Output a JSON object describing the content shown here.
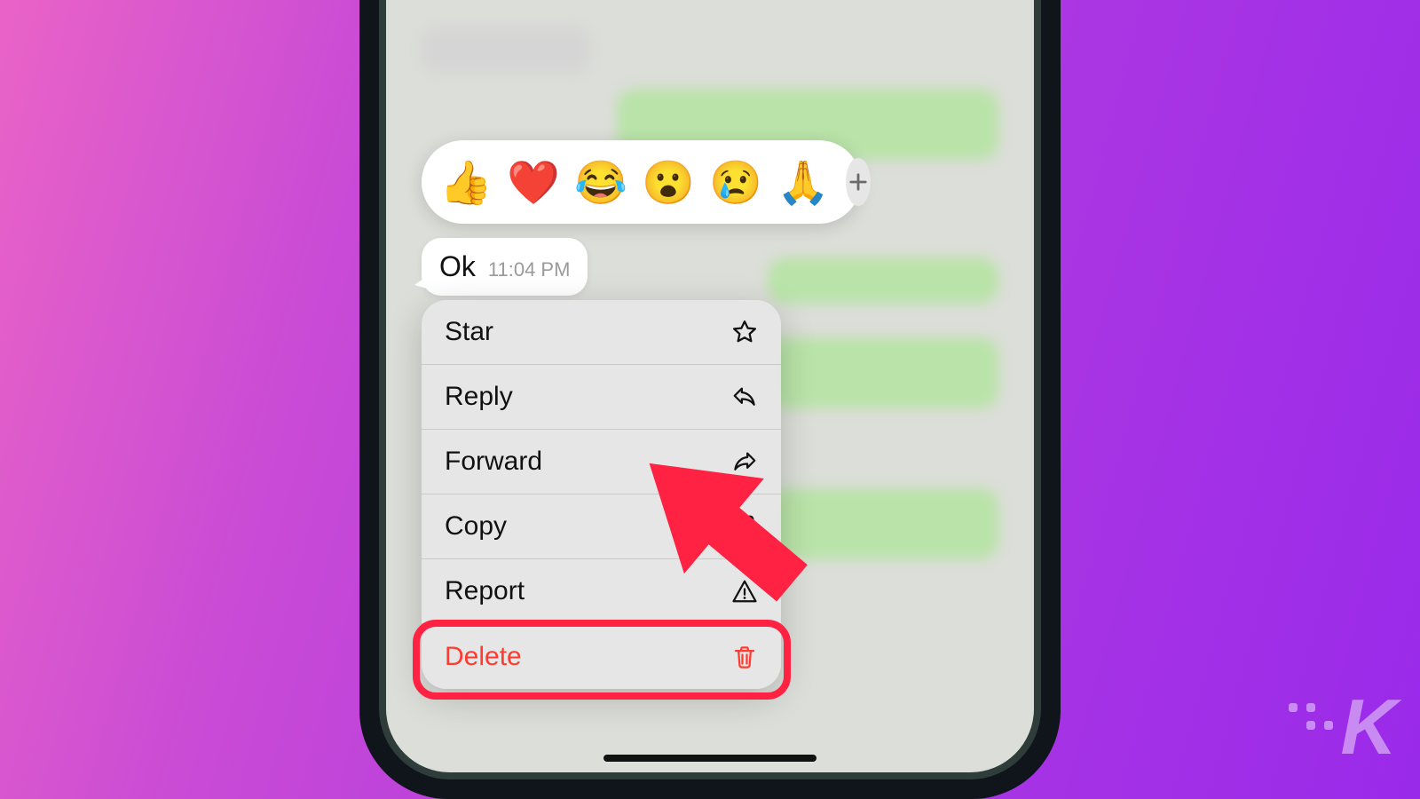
{
  "message": {
    "text": "Ok",
    "time": "11:04 PM"
  },
  "reactions": {
    "items": [
      "👍",
      "❤️",
      "😂",
      "😮",
      "😢",
      "🙏"
    ]
  },
  "menu": {
    "items": [
      {
        "label": "Star",
        "icon": "star-icon"
      },
      {
        "label": "Reply",
        "icon": "reply-icon"
      },
      {
        "label": "Forward",
        "icon": "forward-icon"
      },
      {
        "label": "Copy",
        "icon": "copy-icon"
      },
      {
        "label": "Report",
        "icon": "report-icon"
      },
      {
        "label": "Delete",
        "icon": "trash-icon",
        "destructive": true,
        "highlighted": true
      }
    ]
  },
  "annotation": {
    "highlight_color": "#ff2242"
  },
  "watermark": {
    "letter": "K"
  }
}
